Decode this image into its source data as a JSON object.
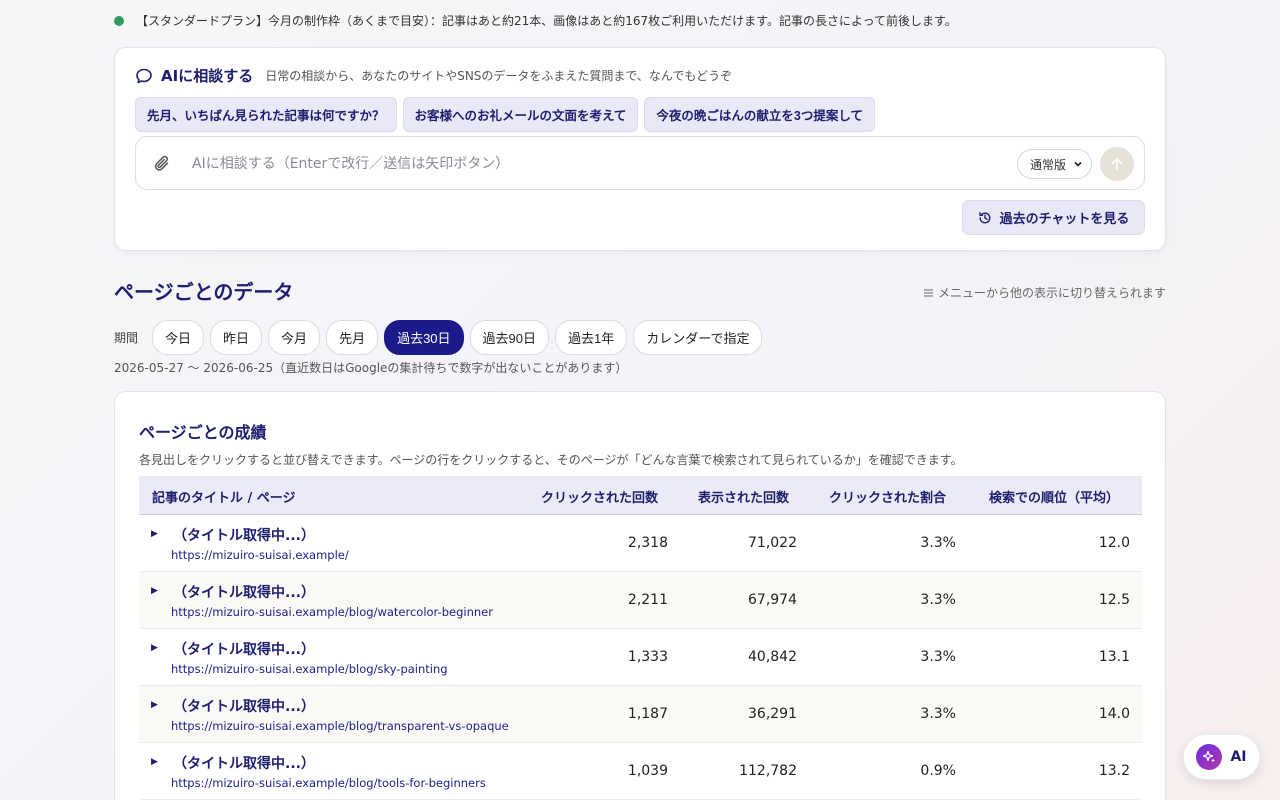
{
  "plan": {
    "text": "【スタンダードプラン】今月の制作枠（あくまで目安）：記事はあと約21本、画像はあと約167枚ご利用いただけます。記事の長さによって前後します。"
  },
  "ai_panel": {
    "title": "AIに相談する",
    "subtitle": "日常の相談から、あなたのサイトやSNSのデータをふまえた質問まで、なんでもどうぞ",
    "suggestions": [
      "先月、いちばん見られた記事は何ですか？",
      "お客様へのお礼メールの文面を考えて",
      "今夜の晩ごはんの献立を3つ提案して"
    ],
    "input_placeholder": "AIに相談する（Enterで改行／送信は矢印ボタン）",
    "mode_value": "通常版",
    "history_label": "過去のチャットを見る"
  },
  "section": {
    "title": "ページごとのデータ",
    "menu_hint": "メニューから他の表示に切り替えられます",
    "period_label": "期間",
    "periods": [
      "今日",
      "昨日",
      "今月",
      "先月",
      "過去30日",
      "過去90日",
      "過去1年",
      "カレンダーで指定"
    ],
    "active_period": "過去30日",
    "date_note": "2026-05-27 〜 2026-06-25（直近数日はGoogleの集計待ちで数字が出ないことがあります）"
  },
  "table": {
    "title": "ページごとの成績",
    "description": "各見出しをクリックすると並び替えできます。ページの行をクリックすると、そのページが「どんな言葉で検索されて見られているか」を確認できます。",
    "headers": {
      "page": "記事のタイトル / ページ",
      "clicks": "クリックされた回数",
      "impressions": "表示された回数",
      "ctr": "クリックされた割合",
      "position": "検索での順位（平均）"
    },
    "rows": [
      {
        "title": "（タイトル取得中...）",
        "url": "https://mizuiro-suisai.example/",
        "clicks": "2,318",
        "impressions": "71,022",
        "ctr": "3.3%",
        "position": "12.0"
      },
      {
        "title": "（タイトル取得中...）",
        "url": "https://mizuiro-suisai.example/blog/watercolor-beginner",
        "clicks": "2,211",
        "impressions": "67,974",
        "ctr": "3.3%",
        "position": "12.5"
      },
      {
        "title": "（タイトル取得中...）",
        "url": "https://mizuiro-suisai.example/blog/sky-painting",
        "clicks": "1,333",
        "impressions": "40,842",
        "ctr": "3.3%",
        "position": "13.1"
      },
      {
        "title": "（タイトル取得中...）",
        "url": "https://mizuiro-suisai.example/blog/transparent-vs-opaque",
        "clicks": "1,187",
        "impressions": "36,291",
        "ctr": "3.3%",
        "position": "14.0"
      },
      {
        "title": "（タイトル取得中...）",
        "url": "https://mizuiro-suisai.example/blog/tools-for-beginners",
        "clicks": "1,039",
        "impressions": "112,782",
        "ctr": "0.9%",
        "position": "13.2"
      }
    ]
  },
  "fab": {
    "label": "AI"
  },
  "colors": {
    "accent": "#1a1a8a",
    "status_green": "#2e9e5e"
  }
}
